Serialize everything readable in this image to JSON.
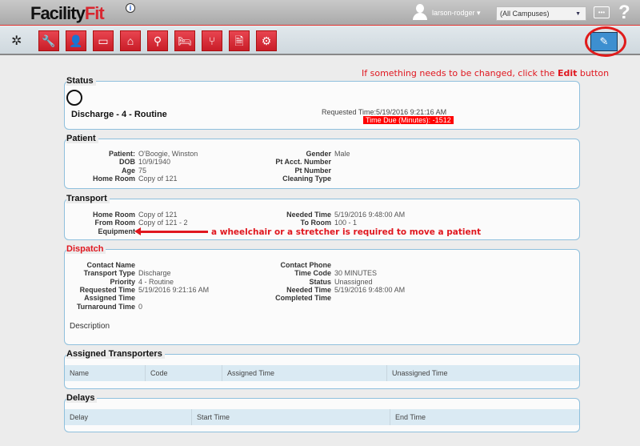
{
  "header": {
    "logo": "Facility",
    "logo_accent": "Fit",
    "info": "i",
    "username": "larson-rodger ▾",
    "campus": "(All Campuses)",
    "chat": "•••",
    "help": "?"
  },
  "toolbar": {
    "tools": [
      "wrench-icon",
      "person-icon",
      "monitor-icon",
      "house-icon",
      "search-icon",
      "bed-icon",
      "chair-icon",
      "document-icon",
      "gears-icon"
    ],
    "tool_glyphs": [
      "🔧",
      "👤",
      "▭",
      "⌂",
      "⚲",
      "🛏",
      "⑂",
      "🗎",
      "⚙"
    ],
    "edit": "✎"
  },
  "hint": {
    "pre": "If something needs to be changed, click the ",
    "bold": "Edit",
    "post": " button"
  },
  "status": {
    "legend": "Status",
    "title": "Discharge - 4 - Routine",
    "requested": "Requested Time:5/19/2016 9:21:16 AM",
    "time_due": "Time Due (Minutes): -1512"
  },
  "patient": {
    "legend": "Patient",
    "left": [
      [
        "Patient:",
        "O'Boogie, Winston"
      ],
      [
        "DOB",
        "10/9/1940"
      ],
      [
        "Age",
        "75"
      ],
      [
        "Home Room",
        "Copy of 121"
      ]
    ],
    "right": [
      [
        "Gender",
        "Male"
      ],
      [
        "Pt Acct. Number",
        ""
      ],
      [
        "Pt Number",
        ""
      ],
      [
        "Cleaning Type",
        ""
      ]
    ]
  },
  "transport": {
    "legend": "Transport",
    "left": [
      [
        "Home Room",
        "Copy of 121"
      ],
      [
        "From Room",
        "Copy of 121 - 2"
      ],
      [
        "Equipment",
        ""
      ]
    ],
    "right": [
      [
        "Needed Time",
        "5/19/2016 9:48:00 AM"
      ],
      [
        "To Room",
        "100  - 1"
      ]
    ],
    "annotation": "a wheelchair or a stretcher is required to move a patient"
  },
  "dispatch": {
    "legend": "Dispatch",
    "left": [
      [
        "Contact Name",
        ""
      ],
      [
        "Transport Type",
        "Discharge"
      ],
      [
        "Priority",
        "4 - Routine"
      ],
      [
        "Requested Time",
        "5/19/2016 9:21:16 AM"
      ],
      [
        "Assigned Time",
        ""
      ],
      [
        "Turnaround Time",
        "0"
      ]
    ],
    "right": [
      [
        "Contact Phone",
        ""
      ],
      [
        "Time Code",
        "30 MINUTES"
      ],
      [
        "Status",
        "Unassigned"
      ],
      [
        "Needed Time",
        "5/19/2016 9:48:00 AM"
      ],
      [
        "Completed Time",
        ""
      ]
    ],
    "description": "Description"
  },
  "assigned": {
    "legend": "Assigned Transporters",
    "columns": [
      "Name",
      "Code",
      "Assigned Time",
      "Unassigned Time"
    ]
  },
  "delays": {
    "legend": "Delays",
    "columns": [
      "Delay",
      "Start Time",
      "End Time"
    ]
  }
}
